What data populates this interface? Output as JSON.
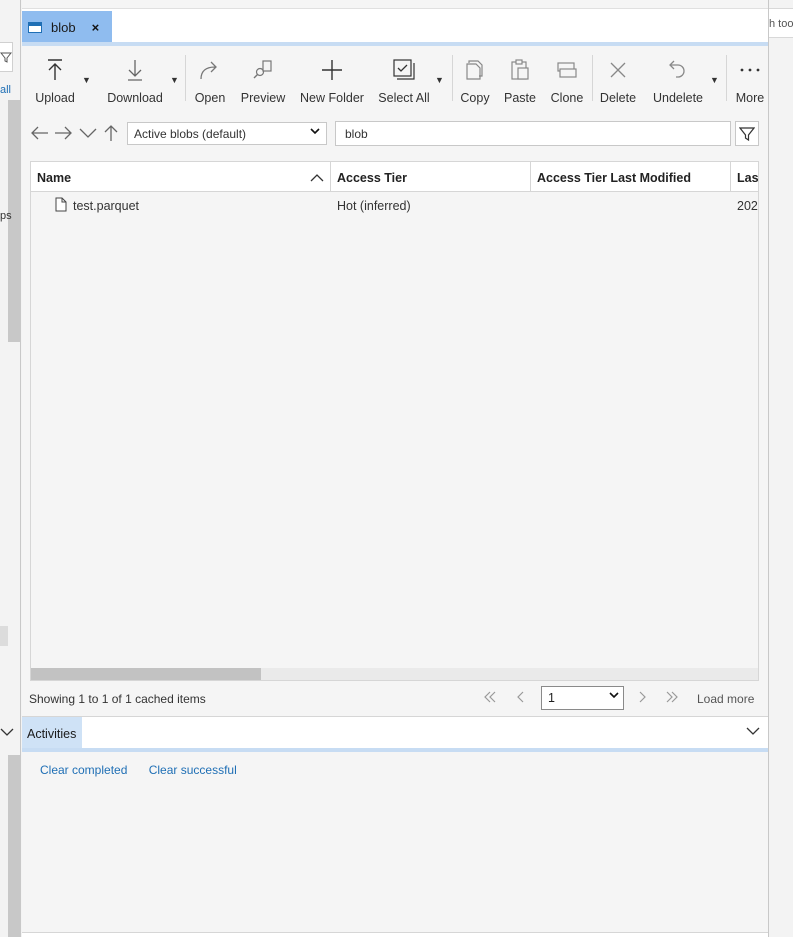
{
  "tab": {
    "label": "blob",
    "close": "×"
  },
  "toolbar": {
    "upload": "Upload",
    "download": "Download",
    "open": "Open",
    "preview": "Preview",
    "new_folder": "New Folder",
    "select_all": "Select All",
    "copy": "Copy",
    "paste": "Paste",
    "clone": "Clone",
    "delete": "Delete",
    "undelete": "Undelete",
    "more": "More"
  },
  "nav": {
    "view_select": "Active blobs (default)",
    "path": "blob"
  },
  "grid": {
    "columns": [
      "Name",
      "Access Tier",
      "Access Tier Last Modified",
      "Last"
    ],
    "rows": [
      {
        "name": "test.parquet",
        "access_tier": "Hot (inferred)",
        "access_tier_last_modified": "",
        "last_modified": "202"
      }
    ]
  },
  "status": {
    "text": "Showing 1 to 1 of 1 cached items",
    "page": "1",
    "load_more": "Load more"
  },
  "activities": {
    "tab": "Activities",
    "clear_completed": "Clear completed",
    "clear_successful": "Clear successful"
  },
  "left_panel": {
    "all": "all",
    "ps": "ps"
  },
  "right_panel": {
    "text": "h too"
  },
  "colors": {
    "accent": "#1f6fb5",
    "tab_active": "#8fbcef",
    "tab_underline": "#c7dcf3"
  }
}
